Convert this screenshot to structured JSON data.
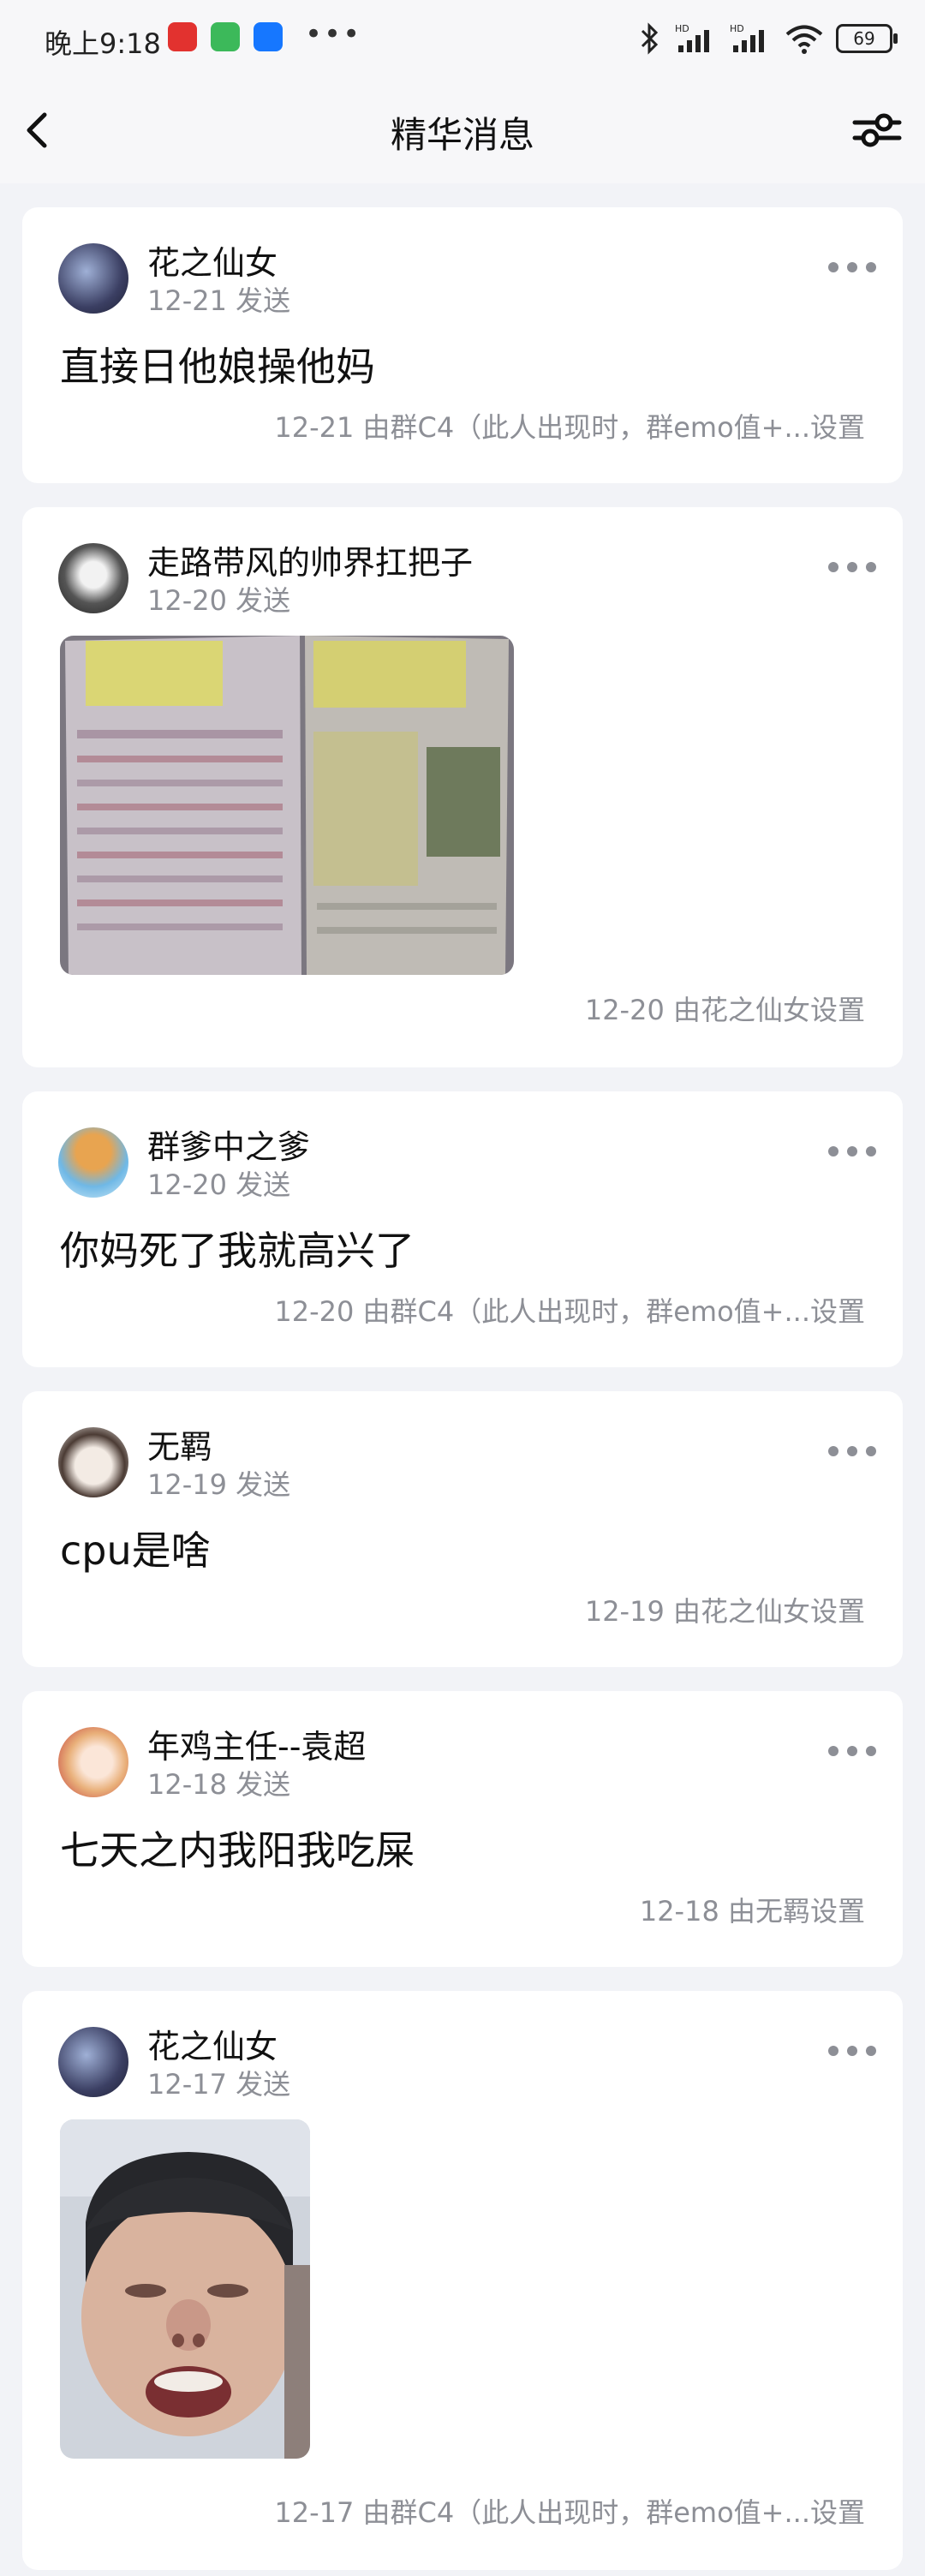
{
  "status_bar": {
    "time": "晚上9:18",
    "battery": "69"
  },
  "header": {
    "title": "精华消息"
  },
  "posts": [
    {
      "username": "花之仙女",
      "sent": "12-21 发送",
      "content": "直接日他娘操他妈",
      "footer": "12-21 由群C4（此人出现时，群emo值+...设置"
    },
    {
      "username": "走路带风的帅界扛把子",
      "sent": "12-20 发送",
      "footer": "12-20 由花之仙女设置"
    },
    {
      "username": "群爹中之爹",
      "sent": "12-20 发送",
      "content": "你妈死了我就高兴了",
      "footer": "12-20 由群C4（此人出现时，群emo值+...设置"
    },
    {
      "username": "无羁",
      "sent": "12-19 发送",
      "content": "cpu是啥",
      "footer": "12-19 由花之仙女设置"
    },
    {
      "username": "年鸡主任--袁超",
      "sent": "12-18 发送",
      "content": "七天之内我阳我吃屎",
      "footer": "12-18 由无羁设置"
    },
    {
      "username": "花之仙女",
      "sent": "12-17 发送",
      "footer": "12-17 由群C4（此人出现时，群emo值+...设置"
    }
  ]
}
